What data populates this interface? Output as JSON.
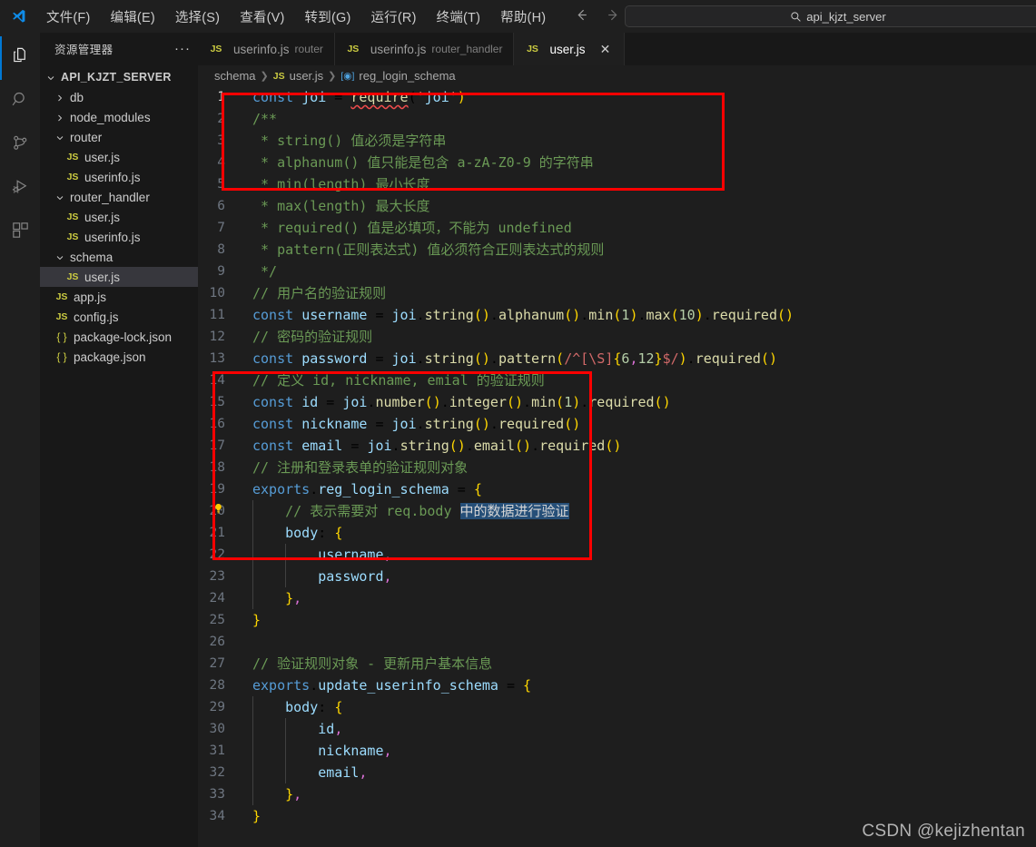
{
  "titlebar": {
    "logo_icon": "vscode-logo-icon",
    "menu": [
      {
        "label": "文件(F)"
      },
      {
        "label": "编辑(E)"
      },
      {
        "label": "选择(S)"
      },
      {
        "label": "查看(V)"
      },
      {
        "label": "转到(G)"
      },
      {
        "label": "运行(R)"
      },
      {
        "label": "终端(T)"
      },
      {
        "label": "帮助(H)"
      }
    ],
    "back_icon": "arrow-left-icon",
    "forward_icon": "arrow-right-icon",
    "quick_search": {
      "icon": "search-icon",
      "value": "api_kjzt_server"
    }
  },
  "activitybar": {
    "items": [
      {
        "name": "explorer",
        "icon": "files-icon",
        "active": true
      },
      {
        "name": "search",
        "icon": "search-icon",
        "active": false
      },
      {
        "name": "source-control",
        "icon": "source-control-icon",
        "active": false
      },
      {
        "name": "run-debug",
        "icon": "run-and-debug-icon",
        "active": false
      },
      {
        "name": "extensions",
        "icon": "extensions-icon",
        "active": false
      }
    ]
  },
  "sidebar": {
    "title": "资源管理器",
    "more_actions": "···",
    "tree": [
      {
        "label": "API_KJZT_SERVER",
        "type": "root",
        "indent": 0,
        "expanded": true
      },
      {
        "label": "db",
        "type": "folder",
        "indent": 1,
        "expanded": false
      },
      {
        "label": "node_modules",
        "type": "folder",
        "indent": 1,
        "expanded": false
      },
      {
        "label": "router",
        "type": "folder",
        "indent": 1,
        "expanded": true
      },
      {
        "label": "user.js",
        "type": "js",
        "indent": 2
      },
      {
        "label": "userinfo.js",
        "type": "js",
        "indent": 2
      },
      {
        "label": "router_handler",
        "type": "folder",
        "indent": 1,
        "expanded": true
      },
      {
        "label": "user.js",
        "type": "js",
        "indent": 2
      },
      {
        "label": "userinfo.js",
        "type": "js",
        "indent": 2
      },
      {
        "label": "schema",
        "type": "folder",
        "indent": 1,
        "expanded": true
      },
      {
        "label": "user.js",
        "type": "js",
        "indent": 2,
        "selected": true
      },
      {
        "label": "app.js",
        "type": "js",
        "indent": 1
      },
      {
        "label": "config.js",
        "type": "js",
        "indent": 1
      },
      {
        "label": "package-lock.json",
        "type": "json",
        "indent": 1
      },
      {
        "label": "package.json",
        "type": "json",
        "indent": 1
      }
    ]
  },
  "editor": {
    "tabs": [
      {
        "icon": "js-file-icon",
        "label": "userinfo.js",
        "description": "router",
        "active": false,
        "closable": false
      },
      {
        "icon": "js-file-icon",
        "label": "userinfo.js",
        "description": "router_handler",
        "active": false,
        "closable": false
      },
      {
        "icon": "js-file-icon",
        "label": "user.js",
        "description": "",
        "active": true,
        "closable": true,
        "close_icon": "close-icon"
      }
    ],
    "breadcrumb": [
      {
        "label": "schema",
        "icon": ""
      },
      {
        "label": "user.js",
        "icon": "js-file-icon"
      },
      {
        "label": "reg_login_schema",
        "icon": "symbol-variable-icon"
      }
    ],
    "active_line": 1,
    "lightbulb_line": 20,
    "lightbulb_icon": "lightbulb-icon",
    "lines": [
      {
        "n": 1,
        "text": "const joi = require('joi')"
      },
      {
        "n": 2,
        "text": "/**"
      },
      {
        "n": 3,
        "text": " * string() 值必须是字符串"
      },
      {
        "n": 4,
        "text": " * alphanum() 值只能是包含 a-zA-Z0-9 的字符串"
      },
      {
        "n": 5,
        "text": " * min(length) 最小长度"
      },
      {
        "n": 6,
        "text": " * max(length) 最大长度"
      },
      {
        "n": 7,
        "text": " * required() 值是必填项，不能为 undefined"
      },
      {
        "n": 8,
        "text": " * pattern(正则表达式) 值必须符合正则表达式的规则"
      },
      {
        "n": 9,
        "text": " */"
      },
      {
        "n": 10,
        "text": "// 用户名的验证规则"
      },
      {
        "n": 11,
        "text": "const username = joi.string().alphanum().min(1).max(10).required()"
      },
      {
        "n": 12,
        "text": "// 密码的验证规则"
      },
      {
        "n": 13,
        "text": "const password = joi.string().pattern(/^[\\S]{6,12}$/).required()"
      },
      {
        "n": 14,
        "text": "// 定义 id, nickname, emial 的验证规则"
      },
      {
        "n": 15,
        "text": "const id = joi.number().integer().min(1).required()"
      },
      {
        "n": 16,
        "text": "const nickname = joi.string().required()"
      },
      {
        "n": 17,
        "text": "const email = joi.string().email().required()"
      },
      {
        "n": 18,
        "text": "// 注册和登录表单的验证规则对象"
      },
      {
        "n": 19,
        "text": "exports.reg_login_schema = {"
      },
      {
        "n": 20,
        "text": "    // 表示需要对 req.body 中的数据进行验证"
      },
      {
        "n": 21,
        "text": "    body: {"
      },
      {
        "n": 22,
        "text": "        username,"
      },
      {
        "n": 23,
        "text": "        password,"
      },
      {
        "n": 24,
        "text": "    },"
      },
      {
        "n": 25,
        "text": "}"
      },
      {
        "n": 26,
        "text": ""
      },
      {
        "n": 27,
        "text": "// 验证规则对象 - 更新用户基本信息"
      },
      {
        "n": 28,
        "text": "exports.update_userinfo_schema = {"
      },
      {
        "n": 29,
        "text": "    body: {"
      },
      {
        "n": 30,
        "text": "        id,"
      },
      {
        "n": 31,
        "text": "        nickname,"
      },
      {
        "n": 32,
        "text": "        email,"
      },
      {
        "n": 33,
        "text": "    },"
      },
      {
        "n": 34,
        "text": "}"
      }
    ],
    "selection_text": "中的数据进行验证",
    "annotations": [
      {
        "name": "red-box-id-nickname-email-rules",
        "lines": "14-17",
        "color": "#fe0000"
      },
      {
        "name": "red-box-update-userinfo-schema",
        "lines": "27-34",
        "color": "#fe0000"
      }
    ]
  },
  "watermark": "CSDN @kejizhentan",
  "colors": {
    "accent": "#0078d4",
    "annotation": "#fe0000",
    "selection": "#264f78",
    "editor_bg": "#1e1e1e",
    "sidebar_bg": "#181818"
  }
}
